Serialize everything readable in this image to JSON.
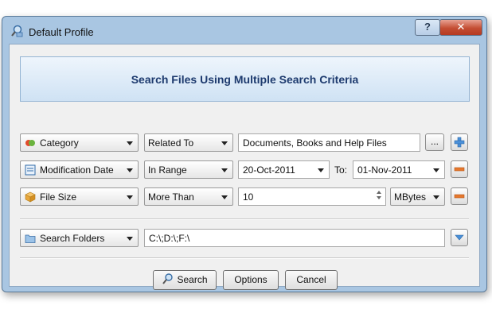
{
  "window": {
    "title": "Default Profile"
  },
  "title_buttons": {
    "help": "?",
    "close": "✕"
  },
  "banner": {
    "text": "Search Files Using Multiple Search Criteria"
  },
  "rows": [
    {
      "field": "Category",
      "operator": "Related To",
      "value": "Documents, Books and Help Files",
      "browse_label": "..."
    },
    {
      "field": "Modification Date",
      "operator": "In Range",
      "from": "20-Oct-2011",
      "to_label": "To:",
      "to": "01-Nov-2011"
    },
    {
      "field": "File Size",
      "operator": "More Than",
      "value": "10",
      "unit": "MBytes"
    }
  ],
  "folders": {
    "label": "Search Folders",
    "value": "C:\\;D:\\;F:\\"
  },
  "buttons": {
    "search": "Search",
    "options": "Options",
    "cancel": "Cancel"
  },
  "colors": {
    "accent": "#1d3a6e",
    "add": "#4a90d9",
    "remove": "#e6782e"
  }
}
